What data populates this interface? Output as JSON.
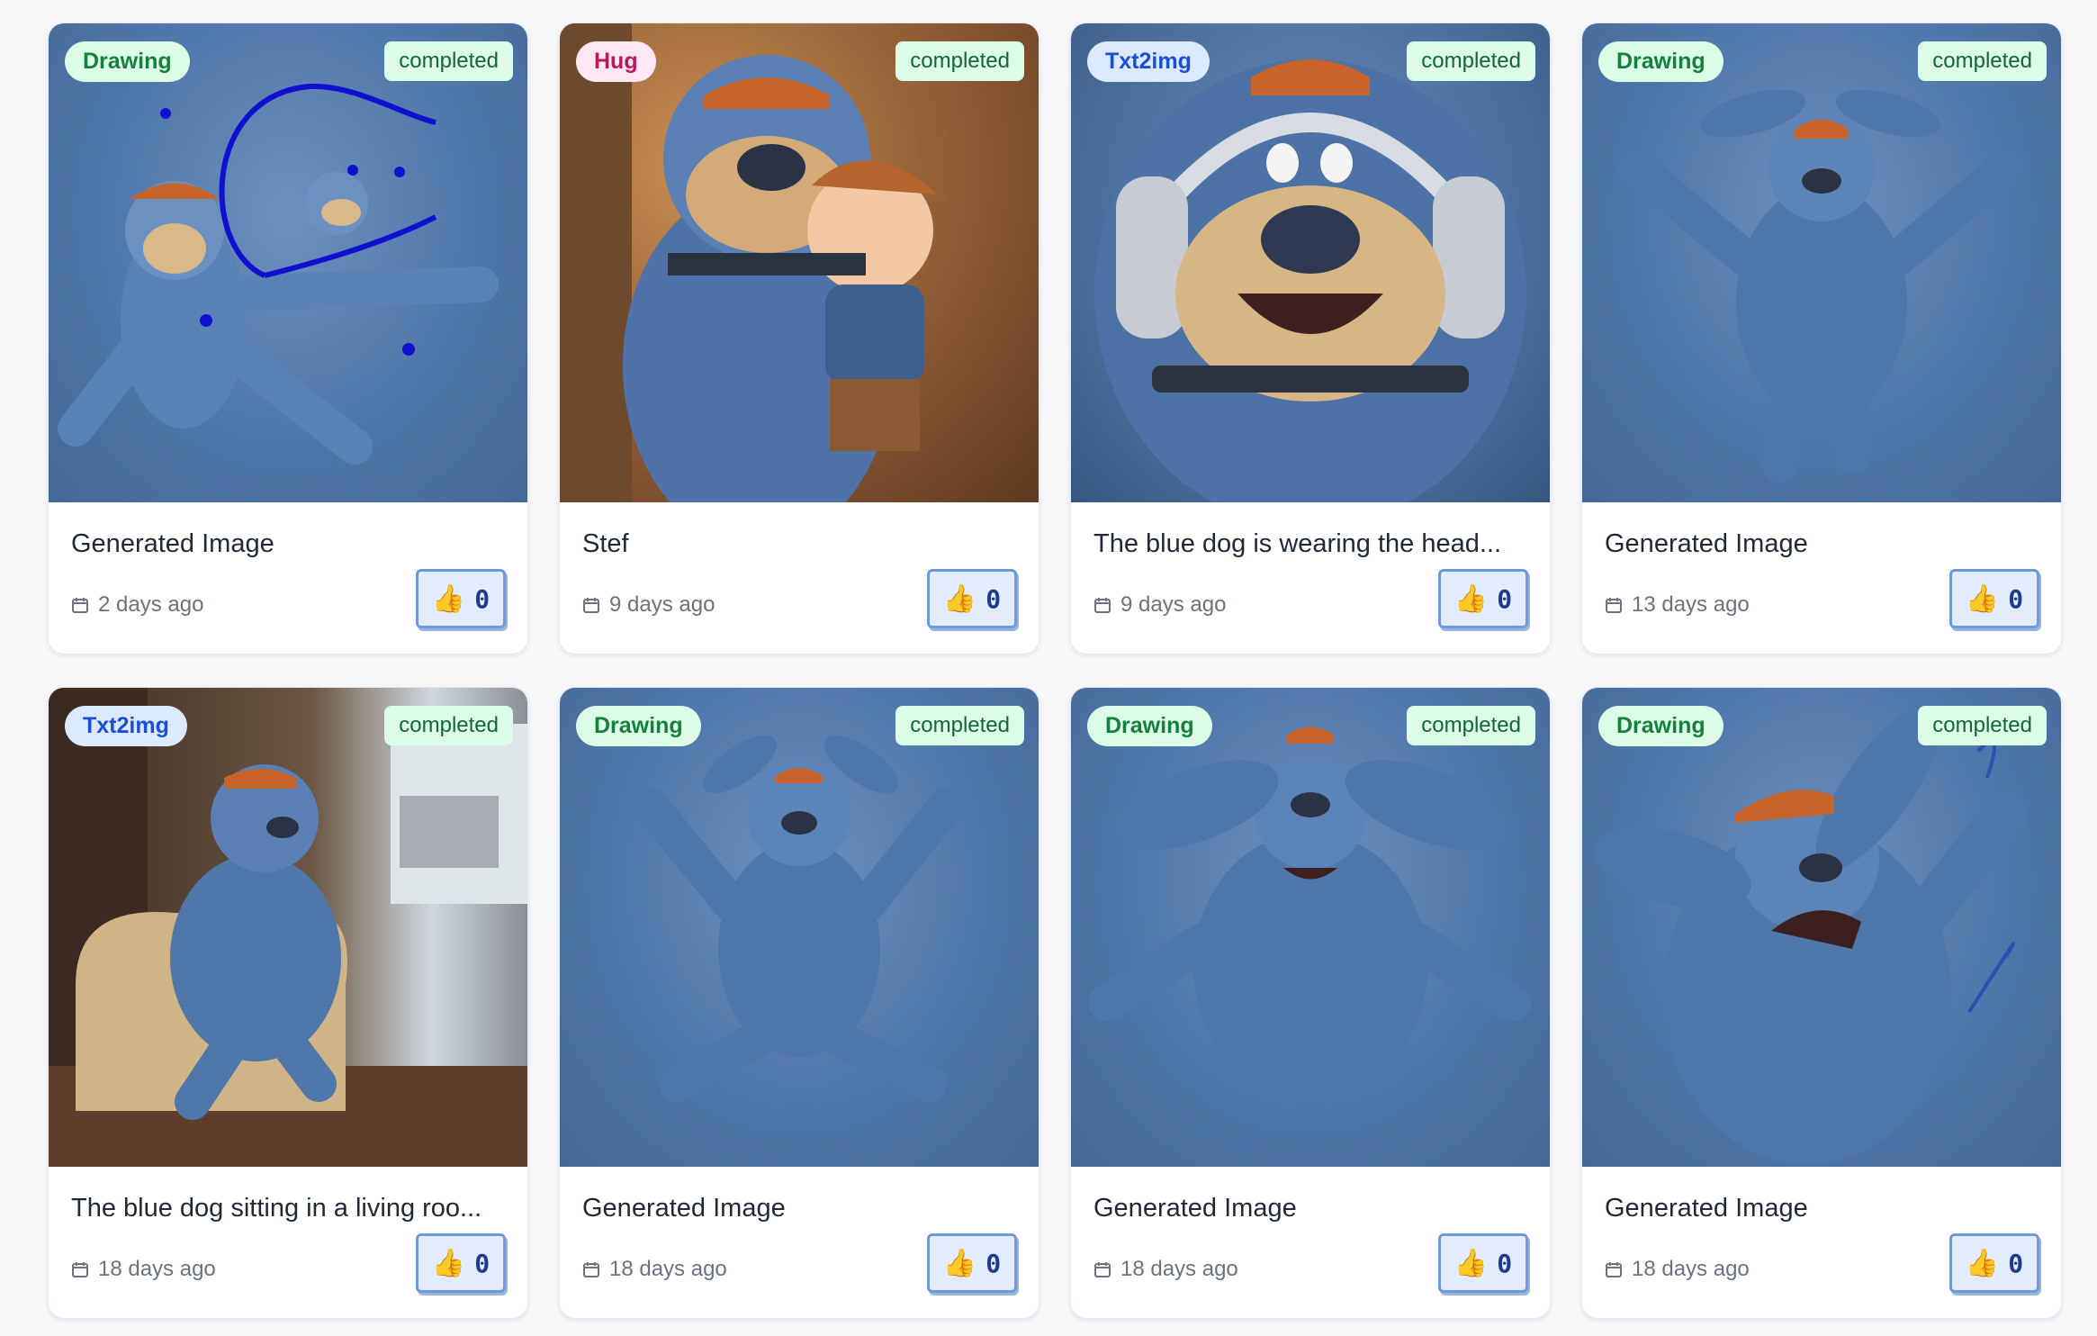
{
  "cards": [
    {
      "tag": "Drawing",
      "status": "completed",
      "title": "Generated Image",
      "date": "2 days ago",
      "likes": "0"
    },
    {
      "tag": "Hug",
      "status": "completed",
      "title": "Stef",
      "date": "9 days ago",
      "likes": "0"
    },
    {
      "tag": "Txt2img",
      "status": "completed",
      "title": "The blue dog is wearing the head...",
      "date": "9 days ago",
      "likes": "0"
    },
    {
      "tag": "Drawing",
      "status": "completed",
      "title": "Generated Image",
      "date": "13 days ago",
      "likes": "0"
    },
    {
      "tag": "Txt2img",
      "status": "completed",
      "title": "The blue dog sitting in a living roo...",
      "date": "18 days ago",
      "likes": "0"
    },
    {
      "tag": "Drawing",
      "status": "completed",
      "title": "Generated Image",
      "date": "18 days ago",
      "likes": "0"
    },
    {
      "tag": "Drawing",
      "status": "completed",
      "title": "Generated Image",
      "date": "18 days ago",
      "likes": "0"
    },
    {
      "tag": "Drawing",
      "status": "completed",
      "title": "Generated Image",
      "date": "18 days ago",
      "likes": "0"
    }
  ],
  "icons": {
    "date": "calendar-icon",
    "like": "thumbs-up-icon",
    "like_glyph": "👍"
  },
  "colors": {
    "dog_blue": "#4f77a9",
    "cap_orange": "#c8642a",
    "drawing_pill": "#dcfce7",
    "hug_pill": "#fce7f3",
    "txt_pill": "#dbeafe"
  }
}
